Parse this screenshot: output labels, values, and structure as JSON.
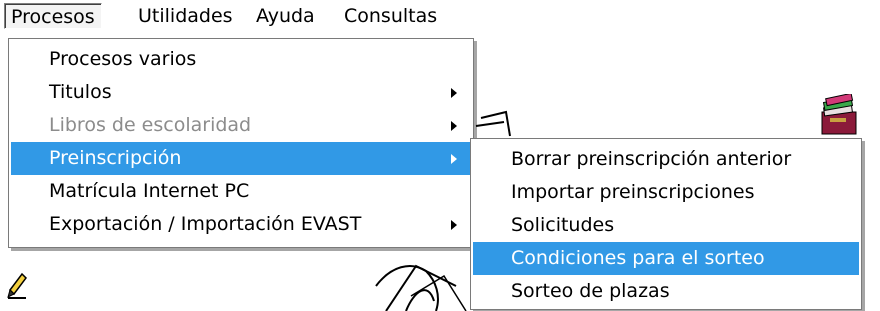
{
  "menubar": {
    "items": [
      {
        "label": "Procesos"
      },
      {
        "label": "Utilidades"
      },
      {
        "label": "Ayuda"
      },
      {
        "label": "Consultas"
      }
    ]
  },
  "procesos_menu": {
    "items": [
      {
        "label": "Procesos varios",
        "state": "normal"
      },
      {
        "label": "Titulos",
        "state": "normal",
        "submenu": true
      },
      {
        "label": "Libros de escolaridad",
        "state": "disabled",
        "submenu": true
      },
      {
        "label": "Preinscripción",
        "state": "highlighted",
        "submenu": true
      },
      {
        "label": "Matrícula Internet PC",
        "state": "normal"
      },
      {
        "label": "Exportación / Importación EVAST",
        "state": "normal",
        "submenu": true
      }
    ]
  },
  "preinscripcion_submenu": {
    "items": [
      {
        "label": "Borrar preinscripción anterior",
        "state": "normal"
      },
      {
        "label": "Importar preinscripciones",
        "state": "normal"
      },
      {
        "label": "Solicitudes",
        "state": "normal"
      },
      {
        "label": "Condiciones para el sorteo",
        "state": "highlighted"
      },
      {
        "label": "Sorteo de plazas",
        "state": "normal"
      }
    ]
  },
  "colors": {
    "highlight": "#3199e6",
    "disabled_text": "#8c8c8c",
    "menu_border": "#7a7a7a"
  },
  "icons": [
    "books-icon",
    "pencil-icon",
    "background-drawing"
  ]
}
